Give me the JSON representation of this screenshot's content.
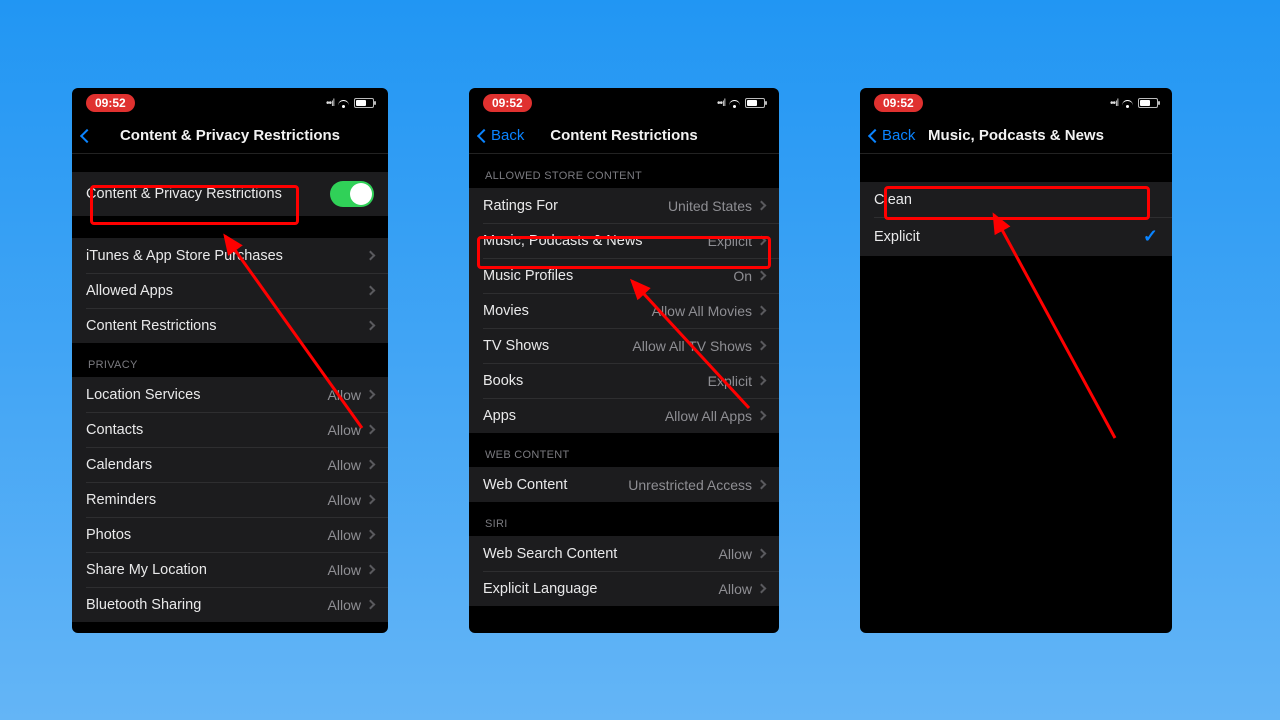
{
  "status": {
    "time": "09:52"
  },
  "screen1": {
    "title": "Content & Privacy Restrictions",
    "backLabel": "",
    "toggleRow": "Content & Privacy Restrictions",
    "items": [
      {
        "label": "iTunes & App Store Purchases"
      },
      {
        "label": "Allowed Apps"
      },
      {
        "label": "Content Restrictions"
      }
    ],
    "privacyHeader": "PRIVACY",
    "privacy": [
      {
        "label": "Location Services",
        "value": "Allow"
      },
      {
        "label": "Contacts",
        "value": "Allow"
      },
      {
        "label": "Calendars",
        "value": "Allow"
      },
      {
        "label": "Reminders",
        "value": "Allow"
      },
      {
        "label": "Photos",
        "value": "Allow"
      },
      {
        "label": "Share My Location",
        "value": "Allow"
      },
      {
        "label": "Bluetooth Sharing",
        "value": "Allow"
      }
    ]
  },
  "screen2": {
    "backLabel": "Back",
    "title": "Content Restrictions",
    "header1": "ALLOWED STORE CONTENT",
    "store": [
      {
        "label": "Ratings For",
        "value": "United States"
      },
      {
        "label": "Music, Podcasts & News",
        "value": "Explicit"
      },
      {
        "label": "Music Profiles",
        "value": "On"
      },
      {
        "label": "Movies",
        "value": "Allow All Movies"
      },
      {
        "label": "TV Shows",
        "value": "Allow All TV Shows"
      },
      {
        "label": "Books",
        "value": "Explicit"
      },
      {
        "label": "Apps",
        "value": "Allow All Apps"
      }
    ],
    "header2": "WEB CONTENT",
    "web": [
      {
        "label": "Web Content",
        "value": "Unrestricted Access"
      }
    ],
    "header3": "SIRI",
    "siri": [
      {
        "label": "Web Search Content",
        "value": "Allow"
      },
      {
        "label": "Explicit Language",
        "value": "Allow"
      }
    ]
  },
  "screen3": {
    "backLabel": "Back",
    "title": "Music, Podcasts & News",
    "options": [
      {
        "label": "Clean",
        "selected": false
      },
      {
        "label": "Explicit",
        "selected": true
      }
    ]
  }
}
